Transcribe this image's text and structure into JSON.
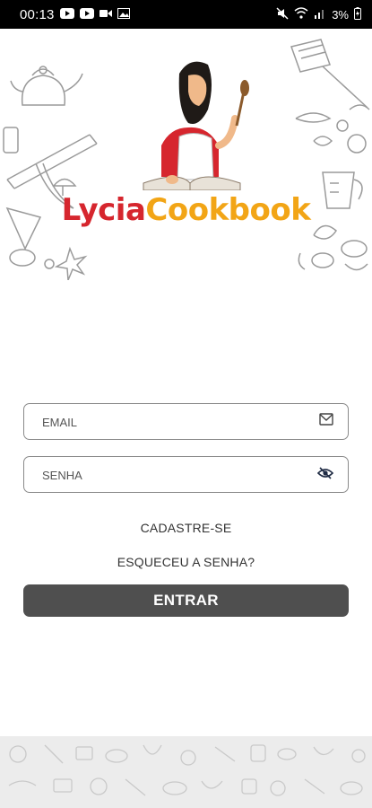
{
  "status_bar": {
    "time": "00:13",
    "battery": "3%",
    "icons": [
      "youtube-icon",
      "youtube-icon",
      "video-camera-icon",
      "gallery-icon",
      "mute-icon",
      "wifi-icon",
      "signal-icon",
      "battery-icon"
    ]
  },
  "brand": {
    "name_part1": "Lycia",
    "name_part2": "Cookbook",
    "color_red": "#d6262e",
    "color_orange": "#f2a516"
  },
  "form": {
    "email_placeholder": "EMAIL",
    "password_placeholder": "SENHA",
    "signup_label": "CADASTRE-SE",
    "forgot_label": "ESQUECEU A SENHA?",
    "submit_label": "ENTRAR"
  },
  "colors": {
    "button_bg": "#4f4f4f",
    "field_border": "#8a8a8a",
    "footer_bg": "#ececec"
  }
}
